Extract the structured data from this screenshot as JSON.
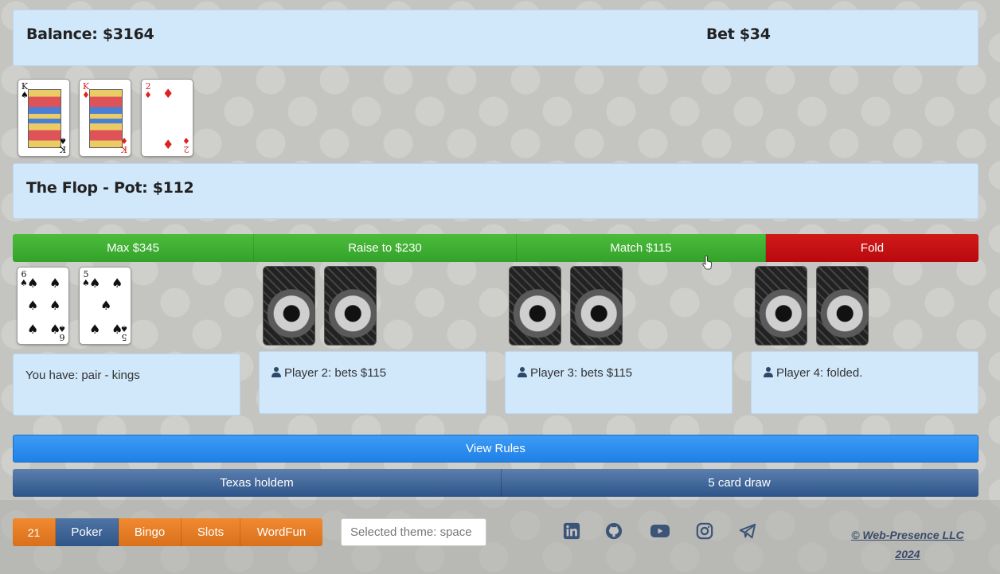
{
  "header": {
    "balance": "Balance: $3164",
    "bet": "Bet $34"
  },
  "board": {
    "cards": [
      {
        "rank": "K",
        "suit": "♠",
        "color": "black",
        "face": true
      },
      {
        "rank": "K",
        "suit": "♦",
        "color": "red",
        "face": true
      },
      {
        "rank": "2",
        "suit": "♦",
        "color": "red",
        "face": false
      }
    ]
  },
  "stage": {
    "title": "The Flop - Pot: $112"
  },
  "actions": {
    "max": "Max $345",
    "raise": "Raise to $230",
    "match": "Match $115",
    "fold": "Fold"
  },
  "colors": {
    "green": "#3caf31",
    "red": "#c90d12",
    "blue": "#2b8cee",
    "steel": "#3e6598",
    "orange": "#e47c25",
    "panel": "#d1e8fb"
  },
  "player_hand": [
    {
      "rank": "6",
      "suit": "♠",
      "color": "black"
    },
    {
      "rank": "5",
      "suit": "♠",
      "color": "black"
    }
  ],
  "players": [
    {
      "status": "You have: pair - kings"
    },
    {
      "status": "Player 2: bets $115",
      "icon": "user-icon"
    },
    {
      "status": "Player 3: bets $115",
      "icon": "user-icon"
    },
    {
      "status": "Player 4: folded.",
      "icon": "user-icon"
    }
  ],
  "rules_button": "View Rules",
  "variants": {
    "texas": "Texas holdem",
    "draw": "5 card draw"
  },
  "nav": {
    "items": [
      "21",
      "Poker",
      "Bingo",
      "Slots",
      "WordFun"
    ],
    "active": "Poker"
  },
  "theme": {
    "value": "Selected theme: space"
  },
  "social": [
    "linkedin-icon",
    "github-icon",
    "youtube-icon",
    "instagram-icon",
    "telegram-icon"
  ],
  "copyright": {
    "line1": "© Web-Presence LLC",
    "line2": "2024"
  }
}
